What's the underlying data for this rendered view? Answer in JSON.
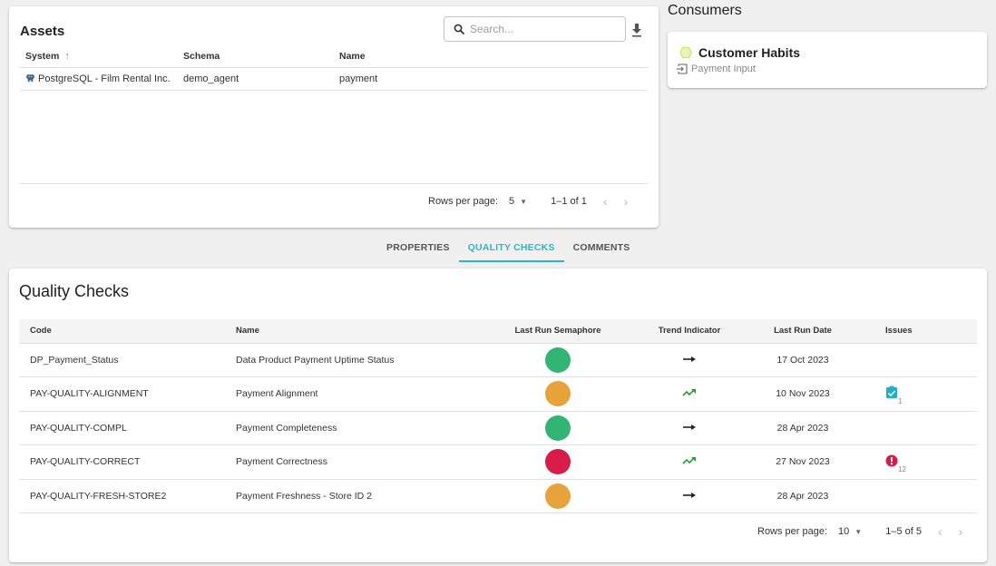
{
  "assets": {
    "title": "Assets",
    "search_placeholder": "Search...",
    "columns": {
      "system": "System",
      "schema": "Schema",
      "name": "Name"
    },
    "sort_indicator": "↑",
    "rows": [
      {
        "system": "PostgreSQL - Film Rental Inc.",
        "schema": "demo_agent",
        "name": "payment",
        "system_icon": "postgresql-icon"
      }
    ],
    "pager": {
      "rows_per_page_label": "Rows per page:",
      "rows_per_page": "5",
      "range": "1–1 of 1",
      "prev": "‹",
      "next": "›"
    }
  },
  "consumers": {
    "title": "Consumers",
    "items": [
      {
        "name": "Customer Habits",
        "icon": "hexagon-icon",
        "icon_color": "#e6f5b8",
        "sub_label": "Payment Input",
        "sub_icon": "input-icon"
      }
    ]
  },
  "tabs": [
    {
      "label": "PROPERTIES",
      "active": false
    },
    {
      "label": "QUALITY CHECKS",
      "active": true
    },
    {
      "label": "COMMENTS",
      "active": false
    }
  ],
  "accent_color": "#2ab7ca",
  "quality_checks": {
    "title": "Quality Checks",
    "columns": {
      "code": "Code",
      "name": "Name",
      "semaphore": "Last Run Semaphore",
      "trend": "Trend Indicator",
      "date": "Last Run Date",
      "issues": "Issues"
    },
    "rows": [
      {
        "code": "DP_Payment_Status",
        "name": "Data Product Payment Uptime Status",
        "semaphore": "green",
        "semaphore_color": "#32b474",
        "trend": "stable",
        "date": "17 Oct 2023",
        "issues": null
      },
      {
        "code": "PAY-QUALITY-ALIGNMENT",
        "name": "Payment Alignment",
        "semaphore": "orange",
        "semaphore_color": "#e8a23a",
        "trend": "up",
        "date": "10 Nov 2023",
        "issues": {
          "type": "resolved",
          "icon": "clipboard-check-icon",
          "color": "#1eaed1",
          "count": "1"
        }
      },
      {
        "code": "PAY-QUALITY-COMPL",
        "name": "Payment Completeness",
        "semaphore": "green",
        "semaphore_color": "#32b474",
        "trend": "stable",
        "date": "28 Apr 2023",
        "issues": null
      },
      {
        "code": "PAY-QUALITY-CORRECT",
        "name": "Payment Correctness",
        "semaphore": "red",
        "semaphore_color": "#d81b48",
        "trend": "up",
        "date": "27 Nov 2023",
        "issues": {
          "type": "open",
          "icon": "alert-circle-icon",
          "color": "#d81b48",
          "count": "12"
        }
      },
      {
        "code": "PAY-QUALITY-FRESH-STORE2",
        "name": "Payment Freshness - Store ID 2",
        "semaphore": "orange",
        "semaphore_color": "#e8a23a",
        "trend": "stable",
        "date": "28 Apr 2023",
        "issues": null
      }
    ],
    "pager": {
      "rows_per_page_label": "Rows per page:",
      "rows_per_page": "10",
      "range": "1–5 of 5",
      "prev": "‹",
      "next": "›"
    }
  }
}
